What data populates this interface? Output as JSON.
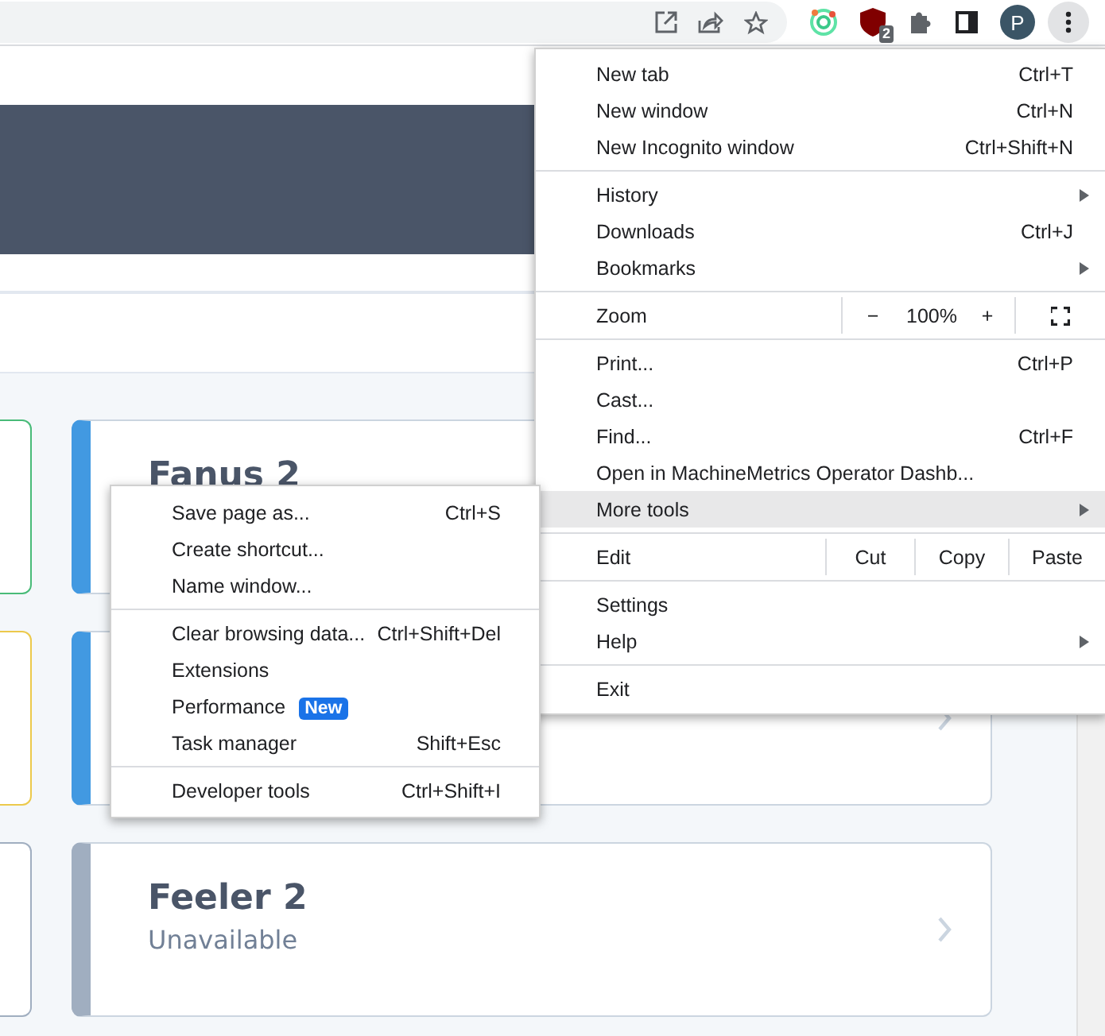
{
  "toolbar": {
    "extension_badge": "2",
    "profile_initial": "P"
  },
  "cards": {
    "left": [
      {
        "color": "#48bb78"
      },
      {
        "color": "#ecc94b"
      },
      {
        "color": "#a0aec0"
      }
    ],
    "right": [
      {
        "title": "Fanus 2",
        "color": "#4299e1"
      },
      {
        "color": "#4299e1",
        "chevron": true
      },
      {
        "title": "Feeler 2",
        "status": "Unavailable",
        "color": "#a0aec0",
        "chevron": true
      }
    ]
  },
  "menu": {
    "groups": [
      [
        {
          "kind": "item",
          "label": "New tab",
          "shortcut": "Ctrl+T"
        },
        {
          "kind": "item",
          "label": "New window",
          "shortcut": "Ctrl+N"
        },
        {
          "kind": "item",
          "label": "New Incognito window",
          "shortcut": "Ctrl+Shift+N"
        }
      ],
      [
        {
          "kind": "item",
          "label": "History",
          "has_submenu": true
        },
        {
          "kind": "item",
          "label": "Downloads",
          "shortcut": "Ctrl+J"
        },
        {
          "kind": "item",
          "label": "Bookmarks",
          "has_submenu": true
        }
      ],
      [
        {
          "kind": "zoom",
          "label": "Zoom",
          "minus": "−",
          "value": "100%",
          "plus": "+"
        }
      ],
      [
        {
          "kind": "item",
          "label": "Print...",
          "shortcut": "Ctrl+P"
        },
        {
          "kind": "item",
          "label": "Cast..."
        },
        {
          "kind": "item",
          "label": "Find...",
          "shortcut": "Ctrl+F"
        },
        {
          "kind": "item",
          "label": "Open in MachineMetrics Operator Dashb..."
        },
        {
          "kind": "item",
          "label": "More tools",
          "has_submenu": true,
          "selected": true
        }
      ],
      [
        {
          "kind": "edit",
          "label": "Edit",
          "actions": [
            "Cut",
            "Copy",
            "Paste"
          ]
        }
      ],
      [
        {
          "kind": "item",
          "label": "Settings"
        },
        {
          "kind": "item",
          "label": "Help",
          "has_submenu": true
        }
      ],
      [
        {
          "kind": "item",
          "label": "Exit"
        }
      ]
    ]
  },
  "submenu": {
    "groups": [
      [
        {
          "label": "Save page as...",
          "shortcut": "Ctrl+S"
        },
        {
          "label": "Create shortcut..."
        },
        {
          "label": "Name window..."
        }
      ],
      [
        {
          "label": "Clear browsing data...",
          "shortcut": "Ctrl+Shift+Del"
        },
        {
          "label": "Extensions"
        },
        {
          "label": "Performance",
          "badge": "New"
        },
        {
          "label": "Task manager",
          "shortcut": "Shift+Esc"
        }
      ],
      [
        {
          "label": "Developer tools",
          "shortcut": "Ctrl+Shift+I"
        }
      ]
    ]
  }
}
